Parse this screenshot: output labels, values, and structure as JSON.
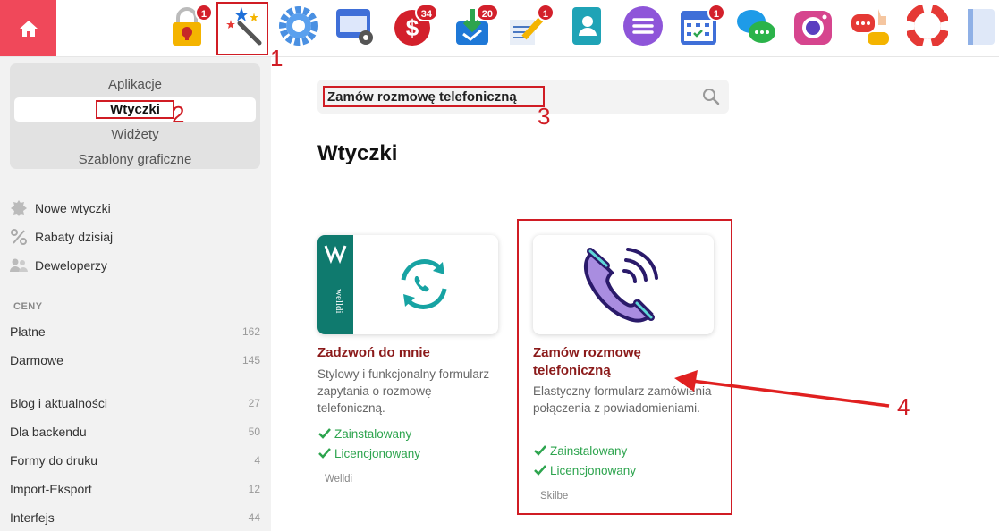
{
  "topbar": {
    "apps": [
      {
        "name": "lock-app-icon",
        "badge": "1"
      },
      {
        "name": "magic-wand-app-icon",
        "badge": ""
      },
      {
        "name": "settings-gear-app-icon",
        "badge": ""
      },
      {
        "name": "window-settings-app-icon",
        "badge": ""
      },
      {
        "name": "dollar-app-icon",
        "badge": "34"
      },
      {
        "name": "download-tray-app-icon",
        "badge": "20"
      },
      {
        "name": "note-pencil-app-icon",
        "badge": "1"
      },
      {
        "name": "contacts-book-app-icon",
        "badge": ""
      },
      {
        "name": "menu-lines-app-icon",
        "badge": ""
      },
      {
        "name": "calendar-app-icon",
        "badge": "1"
      },
      {
        "name": "chat-bubbles-app-icon",
        "badge": ""
      },
      {
        "name": "camera-app-icon",
        "badge": ""
      },
      {
        "name": "chat-thumbs-app-icon",
        "badge": ""
      },
      {
        "name": "lifebuoy-app-icon",
        "badge": ""
      },
      {
        "name": "partial-app-icon",
        "badge": ""
      }
    ]
  },
  "sidebar": {
    "segments": [
      "Aplikacje",
      "Wtyczki",
      "Widżety",
      "Szablony graficzne"
    ],
    "links": [
      "Nowe wtyczki",
      "Rabaty dzisiaj",
      "Deweloperzy"
    ],
    "prices_header": "CENY",
    "prices": [
      {
        "label": "Płatne",
        "count": "162"
      },
      {
        "label": "Darmowe",
        "count": "145"
      }
    ],
    "categories": [
      {
        "label": "Blog i aktualności",
        "count": "27"
      },
      {
        "label": "Dla backendu",
        "count": "50"
      },
      {
        "label": "Formy do druku",
        "count": "4"
      },
      {
        "label": "Import-Eksport",
        "count": "12"
      },
      {
        "label": "Interfejs",
        "count": "44"
      }
    ]
  },
  "main": {
    "search_value": "Zamów rozmowę telefoniczną",
    "page_title": "Wtyczki",
    "cards": [
      {
        "title": "Zadzwoń do mnie",
        "desc": "Stylowy i funkcjonalny formularz zapytania o rozmowę telefoniczną.",
        "status1": "Zainstalowany",
        "status2": "Licencjonowany",
        "vendor": "Welldi",
        "brand_text": "welldi"
      },
      {
        "title_line1": "Zamów rozmowę",
        "title_line2": "telefoniczną",
        "desc": "Elastyczny formularz zamówienia połączenia z powiadomieniami.",
        "status1": "Zainstalowany",
        "status2": "Licencjonowany",
        "vendor": "Skilbe"
      }
    ]
  },
  "annotations": [
    "1",
    "2",
    "3",
    "4"
  ],
  "colors": {
    "accent_red": "#d01c24",
    "home_bg": "#f0485a",
    "title_red": "#8b1a1a",
    "status_green": "#2da44e",
    "welldi_teal": "#0f7a6e"
  }
}
